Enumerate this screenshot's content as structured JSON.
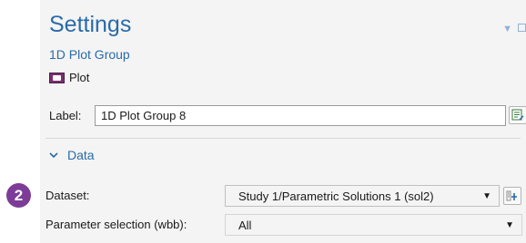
{
  "badge": {
    "number": "2"
  },
  "header": {
    "title": "Settings",
    "subtitle": "1D Plot Group",
    "plot_button_label": "Plot"
  },
  "label_field": {
    "label": "Label:",
    "value": "1D Plot Group 8"
  },
  "data_section": {
    "title": "Data",
    "dataset_label": "Dataset:",
    "dataset_value": "Study 1/Parametric Solutions 1 (sol2)",
    "parameter_label": "Parameter selection (wbb):",
    "parameter_value": "All"
  },
  "colors": {
    "accent": "#2a6ba8",
    "badge": "#7d3c98",
    "panel_bg": "#f4f4f4"
  },
  "icons": {
    "plot": "plot-icon",
    "label_edit": "edit-label-icon",
    "dataset_add": "add-dataset-icon",
    "section_toggle": "chevron-down-icon"
  }
}
